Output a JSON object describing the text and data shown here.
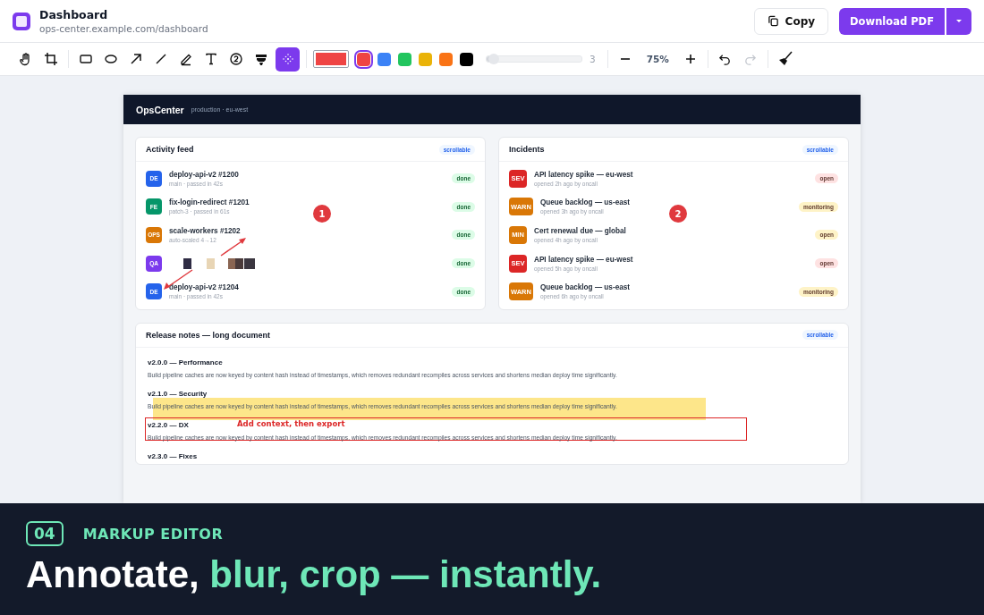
{
  "app": {
    "title": "Dashboard",
    "url": "ops-center.example.com/dashboard",
    "copy_label": "Copy",
    "download_label": "Download PDF"
  },
  "toolbar": {
    "tools": [
      {
        "kind": "hand",
        "selected": false
      },
      {
        "kind": "crop",
        "selected": false
      },
      {
        "kind": "rectangle",
        "selected": false
      },
      {
        "kind": "ellipse",
        "selected": false
      },
      {
        "kind": "arrow",
        "selected": false
      },
      {
        "kind": "line",
        "selected": false
      },
      {
        "kind": "pen",
        "selected": false
      },
      {
        "kind": "text",
        "selected": false
      },
      {
        "kind": "number",
        "selected": false
      },
      {
        "kind": "highlighter",
        "selected": false
      },
      {
        "kind": "blur",
        "selected": true
      }
    ],
    "swatches": [
      {
        "color": "#ef4444",
        "selected": true
      },
      {
        "color": "#3b82f6",
        "selected": false
      },
      {
        "color": "#22c55e",
        "selected": false
      },
      {
        "color": "#eab308",
        "selected": false
      },
      {
        "color": "#f97316",
        "selected": false
      },
      {
        "color": "#000000",
        "selected": false
      }
    ],
    "stroke": {
      "level": 0.08,
      "reading": "3"
    },
    "zoom": "75%",
    "history": [
      {
        "kind": "undo",
        "disabled": false
      },
      {
        "kind": "redo",
        "disabled": true
      }
    ]
  },
  "dashboard": {
    "brand": "OpsCenter",
    "env": "production · eu-west",
    "activity": {
      "title": "Activity feed",
      "badge": "scrollable",
      "step": "1",
      "annotations": [
        {
          "kind": "arrow_up"
        },
        {
          "kind": "arrow_down"
        }
      ],
      "items": [
        {
          "avatar": "DE",
          "color": "#2563eb",
          "title": "deploy-api-v2 #1200",
          "meta": "main · passed in 42s",
          "status": "done",
          "blurred": false
        },
        {
          "avatar": "FE",
          "color": "#059669",
          "title": "fix-login-redirect #1201",
          "meta": "patch-3 · passed in 61s",
          "status": "done",
          "blurred": false
        },
        {
          "avatar": "OPS",
          "color": "#d97706",
          "title": "scale-workers #1202",
          "meta": "auto-scaled 4→12",
          "status": "done",
          "blurred": false
        },
        {
          "avatar": "QA",
          "color": "#7c3aed",
          "status": "done",
          "blurred": true
        },
        {
          "avatar": "DE",
          "color": "#2563eb",
          "title": "deploy-api-v2 #1204",
          "meta": "main · passed in 42s",
          "status": "done",
          "blurred": false
        }
      ]
    },
    "incidents": {
      "title": "Incidents",
      "badge": "scrollable",
      "step": "2",
      "items": [
        {
          "icon": "SEV",
          "color": "#dc2626",
          "title": "API latency spike — eu-west",
          "meta": "opened 2h ago by oncall",
          "status": {
            "label": "open",
            "color": "#fee2e2"
          }
        },
        {
          "icon": "WARN",
          "color": "#d97706",
          "title": "Queue backlog — us-east",
          "meta": "opened 3h ago by oncall",
          "status": {
            "label": "monitoring",
            "color": "#fef3c7"
          }
        },
        {
          "icon": "MIN",
          "color": "#d97706",
          "title": "Cert renewal due — global",
          "meta": "opened 4h ago by oncall",
          "status": {
            "label": "open",
            "color": "#fef3c7"
          }
        },
        {
          "icon": "SEV",
          "color": "#dc2626",
          "title": "API latency spike — eu-west",
          "meta": "opened 5h ago by oncall",
          "status": {
            "label": "open",
            "color": "#fee2e2"
          }
        },
        {
          "icon": "WARN",
          "color": "#d97706",
          "title": "Queue backlog — us-east",
          "meta": "opened 6h ago by oncall",
          "status": {
            "label": "monitoring",
            "color": "#fef3c7"
          }
        }
      ]
    },
    "release_notes": {
      "title": "Release notes — long document",
      "badge": "scrollable",
      "notes": [
        {
          "heading": "v2.0.0 — Performance",
          "body": "Build pipeline caches are now keyed by content hash instead of timestamps, which removes redundant recompiles across services and shortens median deploy time significantly.",
          "highlighted": false
        },
        {
          "heading": "v2.1.0 — Security",
          "body": "Build pipeline caches are now keyed by content hash instead of timestamps, which removes redundant recompiles across services and shortens median deploy time significantly.",
          "highlighted": true
        },
        {
          "heading": "v2.2.0 — DX",
          "body": "Build pipeline caches are now keyed by content hash instead of timestamps, which removes redundant recompiles across services and shortens median deploy time significantly.",
          "highlighted": false,
          "callout": "Add context, then export"
        },
        {
          "heading": "v2.3.0 — Fixes",
          "highlighted": false
        }
      ]
    }
  },
  "banner": {
    "number": "04",
    "label": "MARKUP EDITOR",
    "headline_lead": "Annotate,",
    "headline_accent": "blur, crop — instantly."
  }
}
